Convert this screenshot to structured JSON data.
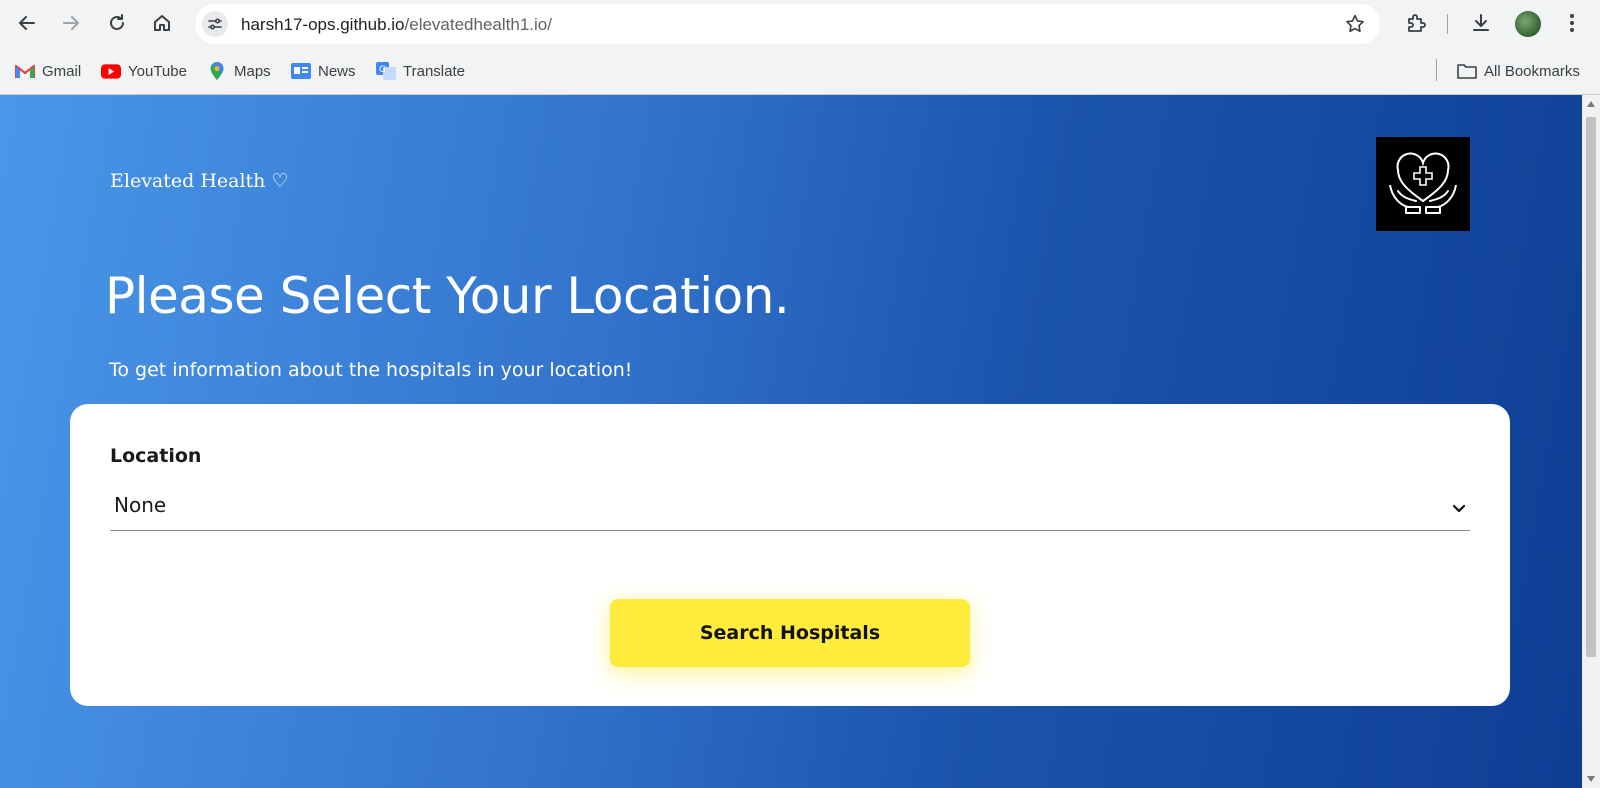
{
  "browser": {
    "url_host": "harsh17-ops.github.io",
    "url_path": "/elevatedhealth1.io/",
    "bookmarks": [
      {
        "label": "Gmail",
        "icon": "gmail-icon"
      },
      {
        "label": "YouTube",
        "icon": "youtube-icon"
      },
      {
        "label": "Maps",
        "icon": "maps-icon"
      },
      {
        "label": "News",
        "icon": "news-icon"
      },
      {
        "label": "Translate",
        "icon": "translate-icon"
      }
    ],
    "all_bookmarks": "All Bookmarks"
  },
  "page": {
    "brand": "Elevated Health ♡",
    "title": "Please Select Your Location.",
    "subtitle": "To get information about the hospitals in your location!",
    "form": {
      "location_label": "Location",
      "location_value": "None",
      "search_button": "Search Hospitals"
    },
    "colors": {
      "gradient_start": "#4a97e9",
      "gradient_end": "#0e3e94",
      "button": "#ffeb3b"
    }
  }
}
